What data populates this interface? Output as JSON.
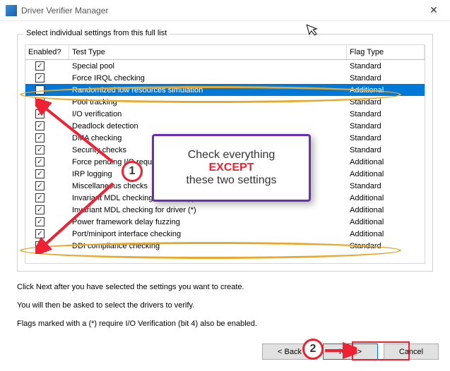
{
  "window": {
    "title": "Driver Verifier Manager"
  },
  "group_label": "Select individual settings from this full list",
  "headers": {
    "enabled": "Enabled?",
    "test_type": "Test Type",
    "flag_type": "Flag Type"
  },
  "rows": [
    {
      "checked": true,
      "name": "Special pool",
      "flag": "Standard",
      "selected": false
    },
    {
      "checked": true,
      "name": "Force IRQL checking",
      "flag": "Standard",
      "selected": false
    },
    {
      "checked": false,
      "name": "Randomized low resources simulation",
      "flag": "Additional",
      "selected": true
    },
    {
      "checked": true,
      "name": "Pool tracking",
      "flag": "Standard",
      "selected": false
    },
    {
      "checked": true,
      "name": "I/O verification",
      "flag": "Standard",
      "selected": false
    },
    {
      "checked": true,
      "name": "Deadlock detection",
      "flag": "Standard",
      "selected": false
    },
    {
      "checked": true,
      "name": "DMA checking",
      "flag": "Standard",
      "selected": false
    },
    {
      "checked": true,
      "name": "Security checks",
      "flag": "Standard",
      "selected": false
    },
    {
      "checked": true,
      "name": "Force pending I/O requests",
      "flag": "Additional",
      "selected": false
    },
    {
      "checked": true,
      "name": "IRP logging",
      "flag": "Additional",
      "selected": false
    },
    {
      "checked": true,
      "name": "Miscellaneous checks",
      "flag": "Standard",
      "selected": false
    },
    {
      "checked": true,
      "name": "Invariant MDL checking for stack (*)",
      "flag": "Additional",
      "selected": false
    },
    {
      "checked": true,
      "name": "Invariant MDL checking for driver (*)",
      "flag": "Additional",
      "selected": false
    },
    {
      "checked": true,
      "name": "Power framework delay fuzzing",
      "flag": "Additional",
      "selected": false
    },
    {
      "checked": true,
      "name": "Port/miniport interface checking",
      "flag": "Additional",
      "selected": false
    },
    {
      "checked": false,
      "name": "DDI compliance checking",
      "flag": "Standard",
      "selected": false
    }
  ],
  "instructions": {
    "line1": "Click Next after you have selected the settings you want to create.",
    "line2": "You will then be asked to select the drivers to verify.",
    "line3": "Flags marked with a (*) require I/O Verification (bit 4) also be enabled."
  },
  "buttons": {
    "back": "< Back",
    "next": "Next >",
    "cancel": "Cancel"
  },
  "annotation": {
    "callout_prefix": "Check everything ",
    "callout_except": "EXCEPT",
    "callout_suffix": "these two settings",
    "badge1": "1",
    "badge2": "2"
  }
}
